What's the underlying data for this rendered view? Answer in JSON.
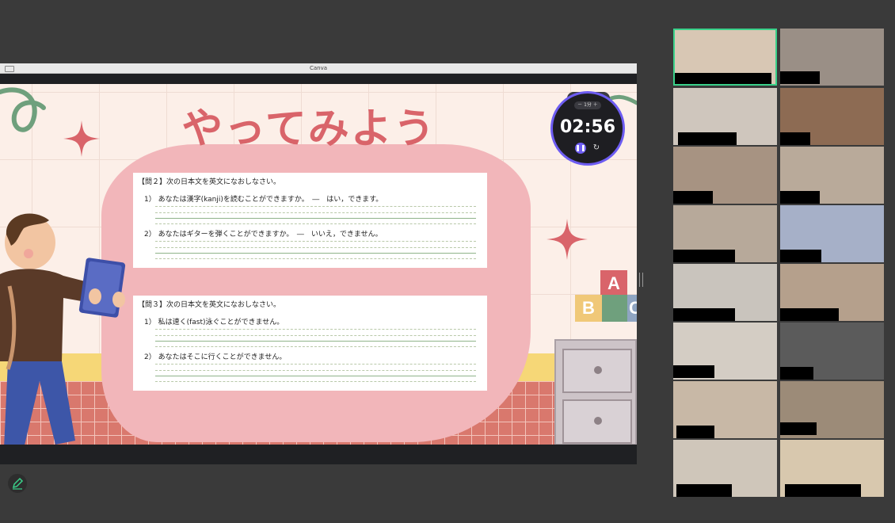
{
  "window": {
    "title": "Canva"
  },
  "slide": {
    "title": "やってみよう",
    "q2": {
      "heading": "【問２】次の日本文を英文になおしなさい。",
      "items": [
        "1）  あなたは漢字(kanji)を読むことができますか。　―　はい，できます。",
        "2）  あなたはギターを弾くことができますか。　―　いいえ，できません。"
      ]
    },
    "q3": {
      "heading": "【問３】次の日本文を英文になおしなさい。",
      "items": [
        "1）  私は速く(fast)泳ぐことができません。",
        "2）  あなたはそこに行くことができません。"
      ]
    },
    "blocks": [
      "A",
      "B",
      "C"
    ]
  },
  "timer": {
    "time": "02:56",
    "adjust": "－  1分  ＋",
    "pause_icon": "pause-icon",
    "reset_icon": "reset-icon"
  },
  "colors": {
    "accent": "#6d5cf2",
    "title_red": "#d9646a",
    "blob_pink": "#f2b6ba",
    "active_speaker": "#3ad18a"
  },
  "participants_count": 16,
  "toolbar": {
    "pen_icon": "pen-icon"
  }
}
